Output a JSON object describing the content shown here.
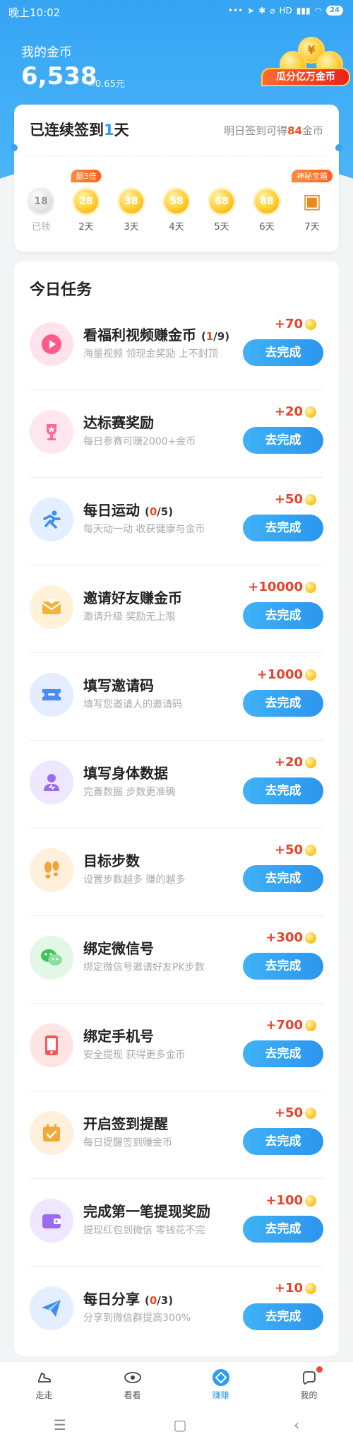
{
  "status": {
    "time": "晚上10:02",
    "signal_text": "HD",
    "battery": "24"
  },
  "header": {
    "title": "我的金币",
    "coins": "6,538",
    "rmb": "≈0.65元",
    "badge": "瓜分亿万金币",
    "treasure_symbol": "¥"
  },
  "checkin": {
    "title_prefix": "已连续签到",
    "title_days": "1",
    "title_suffix": "天",
    "tip_prefix": "明日签到可得",
    "tip_num": "84",
    "tip_suffix": "金币",
    "days": [
      {
        "value": "18",
        "label": "已领",
        "state": "done",
        "tag": ""
      },
      {
        "value": "28",
        "label": "2天",
        "state": "todo",
        "tag": "翻3倍"
      },
      {
        "value": "38",
        "label": "3天",
        "state": "todo",
        "tag": ""
      },
      {
        "value": "58",
        "label": "4天",
        "state": "todo",
        "tag": ""
      },
      {
        "value": "68",
        "label": "5天",
        "state": "todo",
        "tag": ""
      },
      {
        "value": "88",
        "label": "6天",
        "state": "todo",
        "tag": ""
      },
      {
        "value": "",
        "label": "7天",
        "state": "chest",
        "tag": "神秘宝箱"
      }
    ]
  },
  "tasks": {
    "title": "今日任务",
    "button_label": "去完成",
    "items": [
      {
        "name": "看福利视频赚金币",
        "prog_cur": "1",
        "prog_total": "/9",
        "desc": "海量视频 领现金奖励 上不封顶",
        "reward": "+70",
        "icon": "play-icon",
        "color": "#ff5b8a",
        "bg": "#ffe3ec"
      },
      {
        "name": "达标赛奖励",
        "prog_cur": "",
        "prog_total": "",
        "desc": "每日参赛可赚2000+金币",
        "reward": "+20",
        "icon": "trophy-icon",
        "color": "#ff6a9a",
        "bg": "#ffe6ef"
      },
      {
        "name": "每日运动",
        "prog_cur": "0",
        "prog_total": "/5",
        "desc": "每天动一动 收获健康与金币",
        "reward": "+50",
        "icon": "running-icon",
        "color": "#3d8cf0",
        "bg": "#e3efff"
      },
      {
        "name": "邀请好友赚金币",
        "prog_cur": "",
        "prog_total": "",
        "desc": "邀请升级 奖励无上限",
        "reward": "+10000",
        "icon": "envelope-icon",
        "color": "#f3b33a",
        "bg": "#fff2d8"
      },
      {
        "name": "填写邀请码",
        "prog_cur": "",
        "prog_total": "",
        "desc": "填写您邀请人的邀请码",
        "reward": "+1000",
        "icon": "ticket-icon",
        "color": "#4a8cf2",
        "bg": "#e3edff"
      },
      {
        "name": "填写身体数据",
        "prog_cur": "",
        "prog_total": "",
        "desc": "完善数据 步数更准确",
        "reward": "+20",
        "icon": "person-icon",
        "color": "#9b6af0",
        "bg": "#efe6ff"
      },
      {
        "name": "目标步数",
        "prog_cur": "",
        "prog_total": "",
        "desc": "设置步数越多 赚的越多",
        "reward": "+50",
        "icon": "footprint-icon",
        "color": "#f3a43a",
        "bg": "#fff0dc"
      },
      {
        "name": "绑定微信号",
        "prog_cur": "",
        "prog_total": "",
        "desc": "绑定微信号邀请好友PK步数",
        "reward": "+300",
        "icon": "wechat-icon",
        "color": "#3cc35a",
        "bg": "#e2f7e6"
      },
      {
        "name": "绑定手机号",
        "prog_cur": "",
        "prog_total": "",
        "desc": "安全提现 获得更多金币",
        "reward": "+700",
        "icon": "phone-icon",
        "color": "#f25a5a",
        "bg": "#ffe4e4"
      },
      {
        "name": "开启签到提醒",
        "prog_cur": "",
        "prog_total": "",
        "desc": "每日提醒签到赚金币",
        "reward": "+50",
        "icon": "calendar-icon",
        "color": "#f3a83a",
        "bg": "#fff0dc"
      },
      {
        "name": "完成第一笔提现奖励",
        "prog_cur": "",
        "prog_total": "",
        "desc": "提现红包到微信 零钱花不完",
        "reward": "+100",
        "icon": "wallet-icon",
        "color": "#9a6af0",
        "bg": "#efe6ff"
      },
      {
        "name": "每日分享",
        "prog_cur": "0",
        "prog_total": "/3",
        "desc": "分享到微信群提高300%",
        "reward": "+10",
        "icon": "send-icon",
        "color": "#3d8cf0",
        "bg": "#e3efff"
      }
    ]
  },
  "tabbar": [
    {
      "label": "走走",
      "icon": "shoe-icon",
      "active": false
    },
    {
      "label": "看看",
      "icon": "eye-icon",
      "active": false
    },
    {
      "label": "赚赚",
      "icon": "earn-icon",
      "active": true
    },
    {
      "label": "我的",
      "icon": "profile-icon",
      "active": false
    }
  ],
  "sysnav": {
    "menu": "☰",
    "home": "▢",
    "back": "‹"
  }
}
